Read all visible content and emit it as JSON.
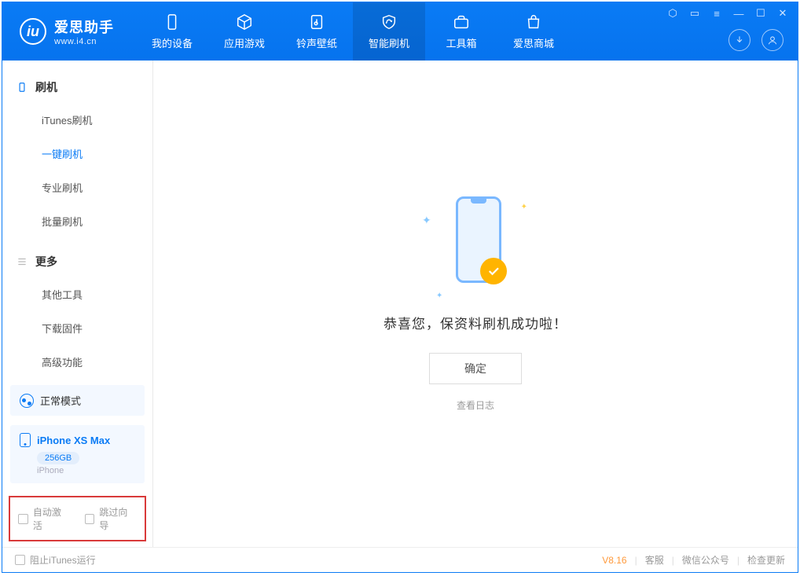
{
  "app": {
    "name_cn": "爱思助手",
    "name_en": "www.i4.cn"
  },
  "nav": {
    "items": [
      {
        "label": "我的设备"
      },
      {
        "label": "应用游戏"
      },
      {
        "label": "铃声壁纸"
      },
      {
        "label": "智能刷机"
      },
      {
        "label": "工具箱"
      },
      {
        "label": "爱思商城"
      }
    ],
    "active_index": 3
  },
  "sidebar": {
    "group1": {
      "title": "刷机",
      "items": [
        {
          "label": "iTunes刷机"
        },
        {
          "label": "一键刷机"
        },
        {
          "label": "专业刷机"
        },
        {
          "label": "批量刷机"
        }
      ],
      "active_index": 1
    },
    "group2": {
      "title": "更多",
      "items": [
        {
          "label": "其他工具"
        },
        {
          "label": "下载固件"
        },
        {
          "label": "高级功能"
        }
      ]
    },
    "mode_label": "正常模式",
    "device": {
      "name": "iPhone XS Max",
      "capacity": "256GB",
      "type": "iPhone"
    },
    "options": {
      "auto_activate": "自动激活",
      "skip_guide": "跳过向导"
    }
  },
  "main": {
    "success_text": "恭喜您，保资料刷机成功啦！",
    "ok_button": "确定",
    "view_log": "查看日志"
  },
  "footer": {
    "block_itunes": "阻止iTunes运行",
    "version": "V8.16",
    "links": {
      "service": "客服",
      "wechat": "微信公众号",
      "update": "检查更新"
    }
  }
}
